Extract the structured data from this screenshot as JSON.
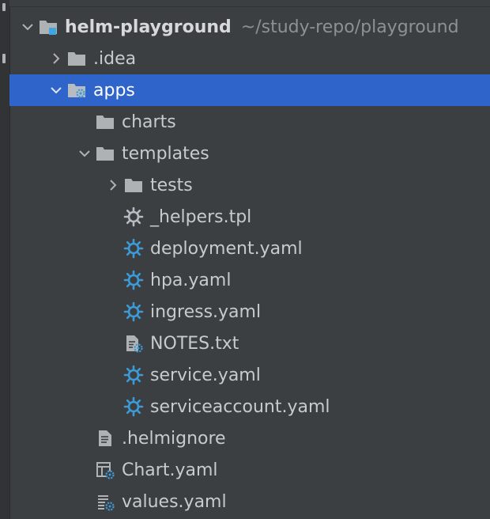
{
  "tree": {
    "root": {
      "name": "helm-playground",
      "path": "~/study-repo/playground"
    },
    "idea": {
      "name": ".idea"
    },
    "apps": {
      "name": "apps"
    },
    "charts": {
      "name": "charts"
    },
    "templates": {
      "name": "templates"
    },
    "tests": {
      "name": "tests"
    },
    "helpers": {
      "name": "_helpers.tpl"
    },
    "deployment": {
      "name": "deployment.yaml"
    },
    "hpa": {
      "name": "hpa.yaml"
    },
    "ingress": {
      "name": "ingress.yaml"
    },
    "notes": {
      "name": "NOTES.txt"
    },
    "service": {
      "name": "service.yaml"
    },
    "serviceaccount": {
      "name": "serviceaccount.yaml"
    },
    "helmignore": {
      "name": ".helmignore"
    },
    "chart": {
      "name": "Chart.yaml"
    },
    "values": {
      "name": "values.yaml"
    }
  },
  "colors": {
    "selection": "#2f65ca",
    "background": "#3c3f41",
    "folder": "#aeb2b5",
    "gear_blue": "#3c9ad6",
    "module_badge": "#3ea7e0"
  }
}
